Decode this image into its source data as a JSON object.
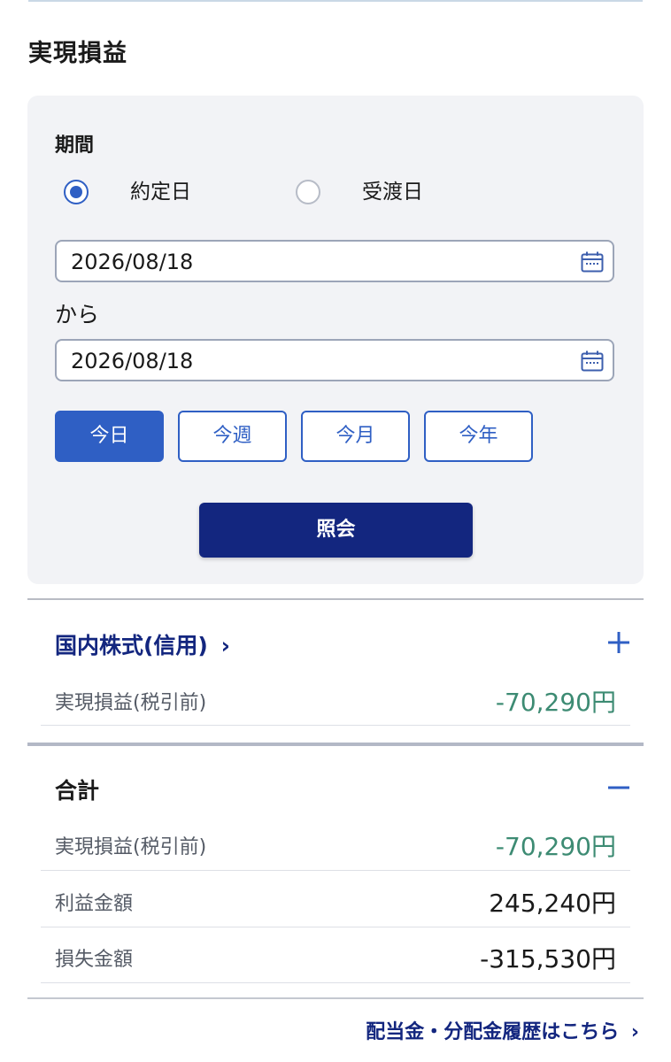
{
  "page_title": "実現損益",
  "filter": {
    "period_label": "期間",
    "radio_options": [
      {
        "label": "約定日",
        "selected": true
      },
      {
        "label": "受渡日",
        "selected": false
      }
    ],
    "start_date": "2026/08/18",
    "from_label": "から",
    "end_date": "2026/08/18",
    "quick_buttons": [
      {
        "label": "今日",
        "active": true
      },
      {
        "label": "今週",
        "active": false
      },
      {
        "label": "今月",
        "active": false
      },
      {
        "label": "今年",
        "active": false
      }
    ],
    "submit_label": "照会"
  },
  "sections": {
    "domestic": {
      "title": "国内株式(信用)",
      "toggle": "+",
      "rows": [
        {
          "label": "実現損益(税引前)",
          "value": "-70,290円"
        }
      ]
    },
    "total": {
      "title": "合計",
      "toggle": "−",
      "rows": [
        {
          "label": "実現損益(税引前)",
          "value": "-70,290円"
        },
        {
          "label": "利益金額",
          "value": "245,240円"
        },
        {
          "label": "損失金額",
          "value": "-315,530円"
        }
      ]
    }
  },
  "footer_link": "配当金・分配金履歴はこちら",
  "colors": {
    "accent": "#2f5fc4",
    "navy": "#13267f",
    "gain_loss_green": "#3d8b73"
  }
}
